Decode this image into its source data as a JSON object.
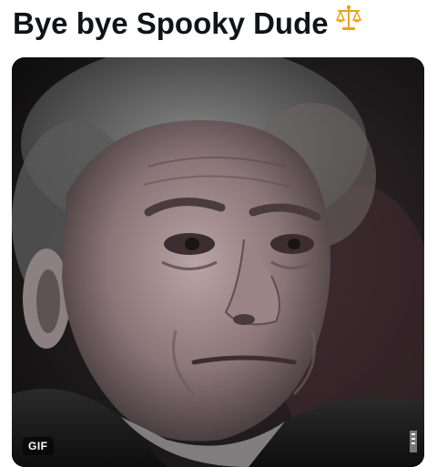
{
  "post": {
    "text": "Bye bye Spooky Dude",
    "emoji": "balance-scale-icon"
  },
  "media": {
    "type": "gif",
    "badge_label": "GIF",
    "description_icon": "portrait-photo"
  },
  "colors": {
    "text": "#0f1419",
    "emoji_gold": "#e8a317",
    "media_bg": "#1a1a1a"
  }
}
